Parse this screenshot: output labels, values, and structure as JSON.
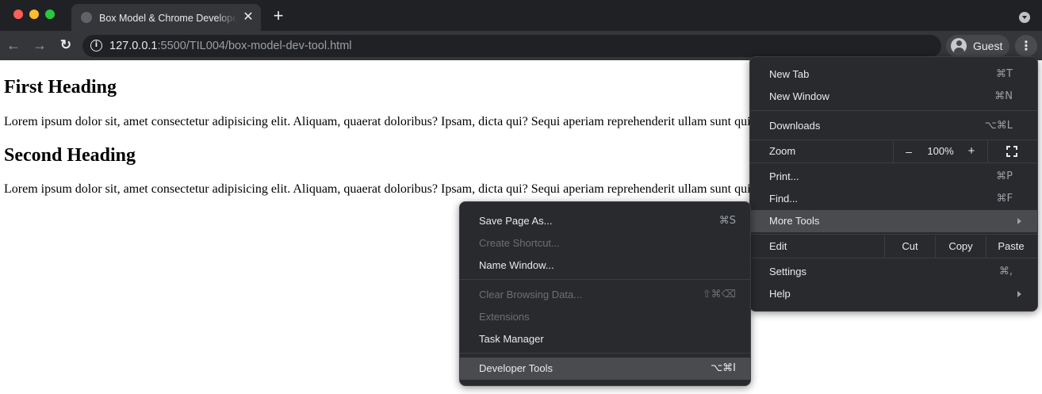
{
  "window": {
    "tab_title": "Box Model & Chrome Developer Tools",
    "tab_close": "✕",
    "new_tab": "+"
  },
  "toolbar": {
    "back": "←",
    "forward": "→",
    "reload": "↻",
    "info": "i",
    "url_host": "127.0.0.1",
    "url_rest": ":5500/TIL004/box-model-dev-tool.html",
    "profile_name": "Guest",
    "menu_dots": "⋮"
  },
  "page": {
    "heading1": "First Heading",
    "paragraph1": "Lorem ipsum dolor sit, amet consectetur adipisicing elit. Aliquam, quaerat doloribus? Ipsam, dicta qui? Sequi aperiam reprehenderit ullam sunt quia.",
    "heading2": "Second Heading",
    "paragraph2": "Lorem ipsum dolor sit, amet consectetur adipisicing elit. Aliquam, quaerat doloribus? Ipsam, dicta qui? Sequi aperiam reprehenderit ullam sunt quia."
  },
  "main_menu": {
    "new_tab": {
      "label": "New Tab",
      "shortcut": "⌘T"
    },
    "new_window": {
      "label": "New Window",
      "shortcut": "⌘N"
    },
    "downloads": {
      "label": "Downloads",
      "shortcut": "⌥⌘L"
    },
    "zoom": {
      "label": "Zoom",
      "minus": "–",
      "value": "100%",
      "plus": "+"
    },
    "print": {
      "label": "Print...",
      "shortcut": "⌘P"
    },
    "find": {
      "label": "Find...",
      "shortcut": "⌘F"
    },
    "more_tools": {
      "label": "More Tools"
    },
    "edit": {
      "label": "Edit",
      "cut": "Cut",
      "copy": "Copy",
      "paste": "Paste"
    },
    "settings": {
      "label": "Settings",
      "shortcut": "⌘,"
    },
    "help": {
      "label": "Help"
    }
  },
  "more_tools_menu": {
    "save_page": {
      "label": "Save Page As...",
      "shortcut": "⌘S"
    },
    "create_shortcut": {
      "label": "Create Shortcut..."
    },
    "name_window": {
      "label": "Name Window..."
    },
    "clear_browsing": {
      "label": "Clear Browsing Data...",
      "shortcut": "⇧⌘⌫"
    },
    "extensions": {
      "label": "Extensions"
    },
    "task_manager": {
      "label": "Task Manager"
    },
    "developer_tools": {
      "label": "Developer Tools",
      "shortcut": "⌥⌘I"
    }
  },
  "colors": {
    "titlebar": "#202124",
    "toolbar": "#35363a",
    "menu_bg": "#292a2d",
    "menu_highlight": "#4a4b4f",
    "text_light": "#e8eaed"
  }
}
